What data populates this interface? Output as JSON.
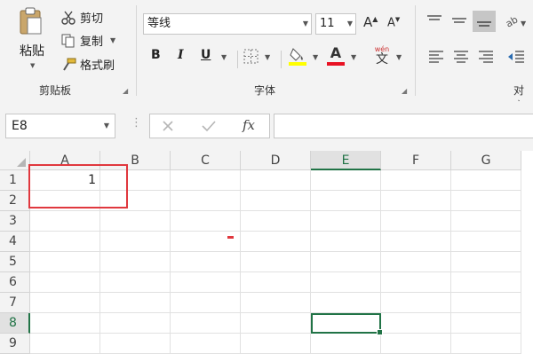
{
  "ribbon": {
    "clipboard": {
      "paste_label": "粘贴",
      "cut_label": "剪切",
      "copy_label": "复制",
      "format_painter_label": "格式刷",
      "group_label": "剪贴板"
    },
    "font": {
      "font_name": "等线",
      "font_size": "11",
      "bold": "B",
      "italic": "I",
      "underline": "U",
      "font_color_glyph": "A",
      "phonetic_top": "wén",
      "phonetic_char": "文",
      "group_label": "字体",
      "font_color": "#e81123",
      "highlight_color": "#ffff00"
    },
    "alignment": {
      "group_label": "对齐"
    }
  },
  "formula_bar": {
    "name_box": "E8",
    "fx_label": "fx",
    "formula": ""
  },
  "sheet": {
    "columns": [
      "A",
      "B",
      "C",
      "D",
      "E",
      "F",
      "G"
    ],
    "rows": [
      "1",
      "2",
      "3",
      "4",
      "5",
      "6",
      "7",
      "8",
      "9"
    ],
    "selected_cell": "E8",
    "cells": {
      "A1": "1"
    },
    "accent_color": "#217346",
    "annotation_color": "#e0383e"
  }
}
